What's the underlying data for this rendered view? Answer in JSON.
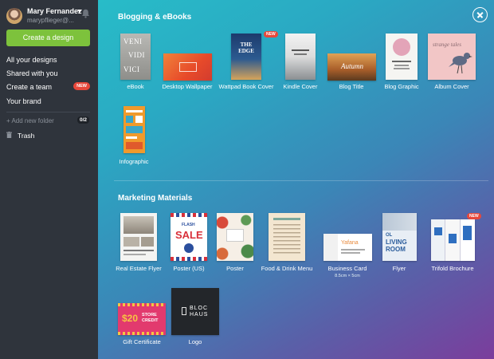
{
  "sidebar": {
    "user_name": "Mary Fernandez",
    "user_email": "marypflieger@...",
    "create_button": "Create a design",
    "nav": [
      "All your designs",
      "Shared with you",
      "Create a team",
      "Your brand"
    ],
    "new_badge": "NEW",
    "add_folder": "+ Add new folder",
    "folder_count": "0/2",
    "trash": "Trash"
  },
  "sections": {
    "blogging": {
      "title": "Blogging & eBooks",
      "items": [
        "eBook",
        "Desktop Wallpaper",
        "Wattpad Book Cover",
        "Kindle Cover",
        "Blog Title",
        "Blog Graphic",
        "Album Cover",
        "Infographic"
      ]
    },
    "marketing": {
      "title": "Marketing Materials",
      "items": [
        "Real Estate Flyer",
        "Poster (US)",
        "Poster",
        "Food & Drink Menu",
        "Business Card",
        "Flyer",
        "Trifold Brochure",
        "Gift Certificate",
        "Logo"
      ],
      "business_card_size": "8.5cm × 5cm"
    }
  },
  "badges": {
    "new": "NEW"
  },
  "thumbnails": {
    "ebook": [
      "VENI",
      "VIDI",
      "VICI"
    ],
    "wattpad": "THE EDGE",
    "blog_title": "Autumn",
    "album": "strange tales",
    "poster_us": [
      "FLASH",
      "SALE"
    ],
    "business_card": "Yafana",
    "flyer": [
      "OL",
      "LIVING",
      "ROOM"
    ],
    "gift": [
      "$20",
      "STORE",
      "CREDIT"
    ],
    "logo": [
      "BLOC",
      "HAUS"
    ]
  },
  "colors": {
    "create_button": "#7dc23c",
    "new_badge": "#e8483b",
    "sidebar": "#2f343c"
  },
  "icons": [
    "bell-icon",
    "close-icon",
    "trash-icon",
    "chevron-down-icon"
  ]
}
